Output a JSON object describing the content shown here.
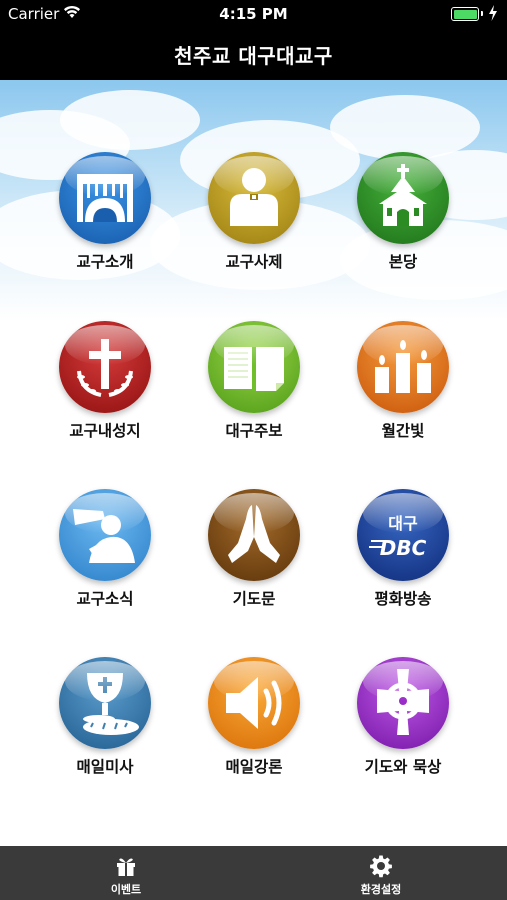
{
  "status_bar": {
    "carrier": "Carrier",
    "time": "4:15 PM"
  },
  "header": {
    "title": "천주교 대구대교구"
  },
  "menu": [
    {
      "label": "교구소개",
      "icon": "cathedral-arch-icon",
      "color": "#1f73c9"
    },
    {
      "label": "교구사제",
      "icon": "priest-icon",
      "color": "#b89a1e"
    },
    {
      "label": "본당",
      "icon": "church-icon",
      "color": "#2a8c22"
    },
    {
      "label": "교구내성지",
      "icon": "cross-wreath-icon",
      "color": "#b01a1a"
    },
    {
      "label": "대구주보",
      "icon": "open-book-icon",
      "color": "#6fbf2a"
    },
    {
      "label": "월간빛",
      "icon": "candles-icon",
      "color": "#e86a14"
    },
    {
      "label": "교구소식",
      "icon": "trumpet-icon",
      "color": "#3d9be0"
    },
    {
      "label": "기도문",
      "icon": "praying-hands-icon",
      "color": "#7a4a16"
    },
    {
      "label": "평화방송",
      "icon": "dbc-logo-icon",
      "color": "#1a3f9a",
      "logo_text_top": "대구",
      "logo_text_bottom": "DBC"
    },
    {
      "label": "매일미사",
      "icon": "chalice-bread-icon",
      "color": "#3f7fb0"
    },
    {
      "label": "매일강론",
      "icon": "speaker-icon",
      "color": "#f08a12"
    },
    {
      "label": "기도와 묵상",
      "icon": "celtic-cross-icon",
      "color": "#9a2cc8"
    }
  ],
  "tabbar": {
    "items": [
      {
        "label": "이벤트",
        "icon": "gift-icon"
      },
      {
        "label": "환경설정",
        "icon": "gear-icon"
      }
    ]
  }
}
